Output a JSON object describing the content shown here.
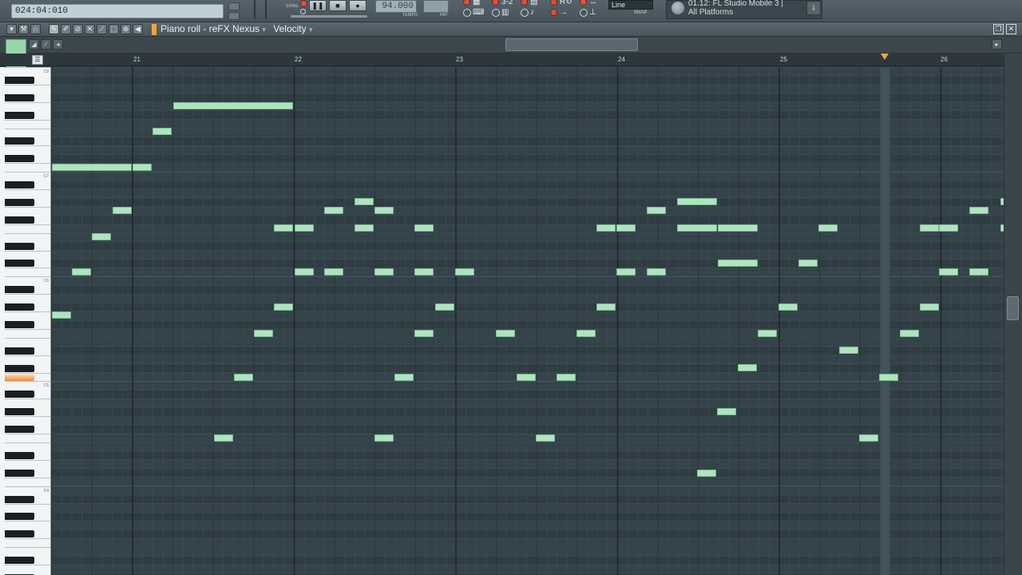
{
  "toolbar": {
    "time_readout": "024:04:010",
    "tempo": "94.000",
    "tempo_label": "TEMPO",
    "pattern_label": "PAT",
    "song_label": "SONG",
    "snap_value": "Line",
    "snap_label": "SNAP",
    "hint_line1": "01.12: FL Studio Mobile 3 |",
    "hint_line2": "All Platforms"
  },
  "piano_roll": {
    "title": "Piano roll - reFX Nexus",
    "dropdown_arrow": "▾",
    "view_mode": "Velocity"
  },
  "timeline": {
    "bars": [
      "21",
      "22",
      "23",
      "24",
      "25",
      "26"
    ]
  },
  "keyboard": {
    "octave_labels": [
      "C8",
      "C7",
      "C6",
      "C5",
      "C4"
    ]
  },
  "colors": {
    "note_fill": "#b0e3c0",
    "grid_bg": "#34434a",
    "accent": "#f3a23a"
  },
  "icons": {
    "play": "play-icon",
    "pause": "pause-icon",
    "stop": "stop-icon",
    "record": "record-icon"
  }
}
